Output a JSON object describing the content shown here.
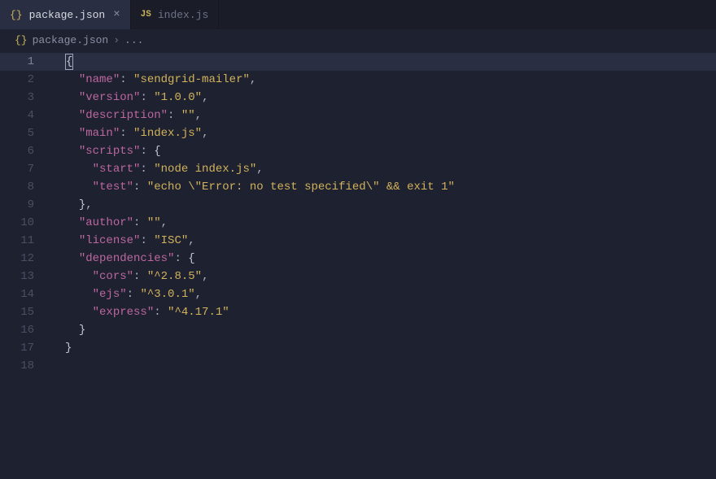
{
  "tabs": [
    {
      "label": "package.json",
      "iconName": "json-braces-icon",
      "iconGlyph": "{}",
      "active": true,
      "closeable": true
    },
    {
      "label": "index.js",
      "iconName": "js-icon",
      "iconGlyph": "JS",
      "active": false,
      "closeable": false
    }
  ],
  "breadcrumb": {
    "iconGlyph": "{}",
    "file": "package.json",
    "chevron": "›",
    "trail": "..."
  },
  "lines": [
    {
      "num": 1,
      "hl": true,
      "tokens": [
        {
          "cls": "cursor-br",
          "t": "{"
        }
      ]
    },
    {
      "num": 2,
      "hl": false,
      "tokens": [
        {
          "cls": "p",
          "t": "  "
        },
        {
          "cls": "k",
          "t": "\"name\""
        },
        {
          "cls": "p",
          "t": ": "
        },
        {
          "cls": "s",
          "t": "\"sendgrid-mailer\""
        },
        {
          "cls": "p",
          "t": ","
        }
      ]
    },
    {
      "num": 3,
      "hl": false,
      "tokens": [
        {
          "cls": "p",
          "t": "  "
        },
        {
          "cls": "k",
          "t": "\"version\""
        },
        {
          "cls": "p",
          "t": ": "
        },
        {
          "cls": "s",
          "t": "\"1.0.0\""
        },
        {
          "cls": "p",
          "t": ","
        }
      ]
    },
    {
      "num": 4,
      "hl": false,
      "tokens": [
        {
          "cls": "p",
          "t": "  "
        },
        {
          "cls": "k",
          "t": "\"description\""
        },
        {
          "cls": "p",
          "t": ": "
        },
        {
          "cls": "s",
          "t": "\"\""
        },
        {
          "cls": "p",
          "t": ","
        }
      ]
    },
    {
      "num": 5,
      "hl": false,
      "tokens": [
        {
          "cls": "p",
          "t": "  "
        },
        {
          "cls": "k",
          "t": "\"main\""
        },
        {
          "cls": "p",
          "t": ": "
        },
        {
          "cls": "s",
          "t": "\"index.js\""
        },
        {
          "cls": "p",
          "t": ","
        }
      ]
    },
    {
      "num": 6,
      "hl": false,
      "tokens": [
        {
          "cls": "p",
          "t": "  "
        },
        {
          "cls": "k",
          "t": "\"scripts\""
        },
        {
          "cls": "p",
          "t": ": "
        },
        {
          "cls": "br",
          "t": "{"
        }
      ]
    },
    {
      "num": 7,
      "hl": false,
      "tokens": [
        {
          "cls": "p",
          "t": "    "
        },
        {
          "cls": "k",
          "t": "\"start\""
        },
        {
          "cls": "p",
          "t": ": "
        },
        {
          "cls": "s",
          "t": "\"node index.js\""
        },
        {
          "cls": "p",
          "t": ","
        }
      ]
    },
    {
      "num": 8,
      "hl": false,
      "tokens": [
        {
          "cls": "p",
          "t": "    "
        },
        {
          "cls": "k",
          "t": "\"test\""
        },
        {
          "cls": "p",
          "t": ": "
        },
        {
          "cls": "s",
          "t": "\"echo \\\"Error: no test specified\\\" && exit 1\""
        }
      ]
    },
    {
      "num": 9,
      "hl": false,
      "tokens": [
        {
          "cls": "p",
          "t": "  "
        },
        {
          "cls": "br",
          "t": "}"
        },
        {
          "cls": "p",
          "t": ","
        }
      ]
    },
    {
      "num": 10,
      "hl": false,
      "tokens": [
        {
          "cls": "p",
          "t": "  "
        },
        {
          "cls": "k",
          "t": "\"author\""
        },
        {
          "cls": "p",
          "t": ": "
        },
        {
          "cls": "s",
          "t": "\"\""
        },
        {
          "cls": "p",
          "t": ","
        }
      ]
    },
    {
      "num": 11,
      "hl": false,
      "tokens": [
        {
          "cls": "p",
          "t": "  "
        },
        {
          "cls": "k",
          "t": "\"license\""
        },
        {
          "cls": "p",
          "t": ": "
        },
        {
          "cls": "s",
          "t": "\"ISC\""
        },
        {
          "cls": "p",
          "t": ","
        }
      ]
    },
    {
      "num": 12,
      "hl": false,
      "tokens": [
        {
          "cls": "p",
          "t": "  "
        },
        {
          "cls": "k",
          "t": "\"dependencies\""
        },
        {
          "cls": "p",
          "t": ": "
        },
        {
          "cls": "br",
          "t": "{"
        }
      ]
    },
    {
      "num": 13,
      "hl": false,
      "tokens": [
        {
          "cls": "p",
          "t": "    "
        },
        {
          "cls": "k",
          "t": "\"cors\""
        },
        {
          "cls": "p",
          "t": ": "
        },
        {
          "cls": "s",
          "t": "\"^2.8.5\""
        },
        {
          "cls": "p",
          "t": ","
        }
      ]
    },
    {
      "num": 14,
      "hl": false,
      "tokens": [
        {
          "cls": "p",
          "t": "    "
        },
        {
          "cls": "k",
          "t": "\"ejs\""
        },
        {
          "cls": "p",
          "t": ": "
        },
        {
          "cls": "s",
          "t": "\"^3.0.1\""
        },
        {
          "cls": "p",
          "t": ","
        }
      ]
    },
    {
      "num": 15,
      "hl": false,
      "tokens": [
        {
          "cls": "p",
          "t": "    "
        },
        {
          "cls": "k",
          "t": "\"express\""
        },
        {
          "cls": "p",
          "t": ": "
        },
        {
          "cls": "s",
          "t": "\"^4.17.1\""
        }
      ]
    },
    {
      "num": 16,
      "hl": false,
      "tokens": [
        {
          "cls": "p",
          "t": "  "
        },
        {
          "cls": "br",
          "t": "}"
        }
      ]
    },
    {
      "num": 17,
      "hl": false,
      "tokens": [
        {
          "cls": "br",
          "t": "}"
        }
      ]
    },
    {
      "num": 18,
      "hl": false,
      "tokens": []
    }
  ]
}
